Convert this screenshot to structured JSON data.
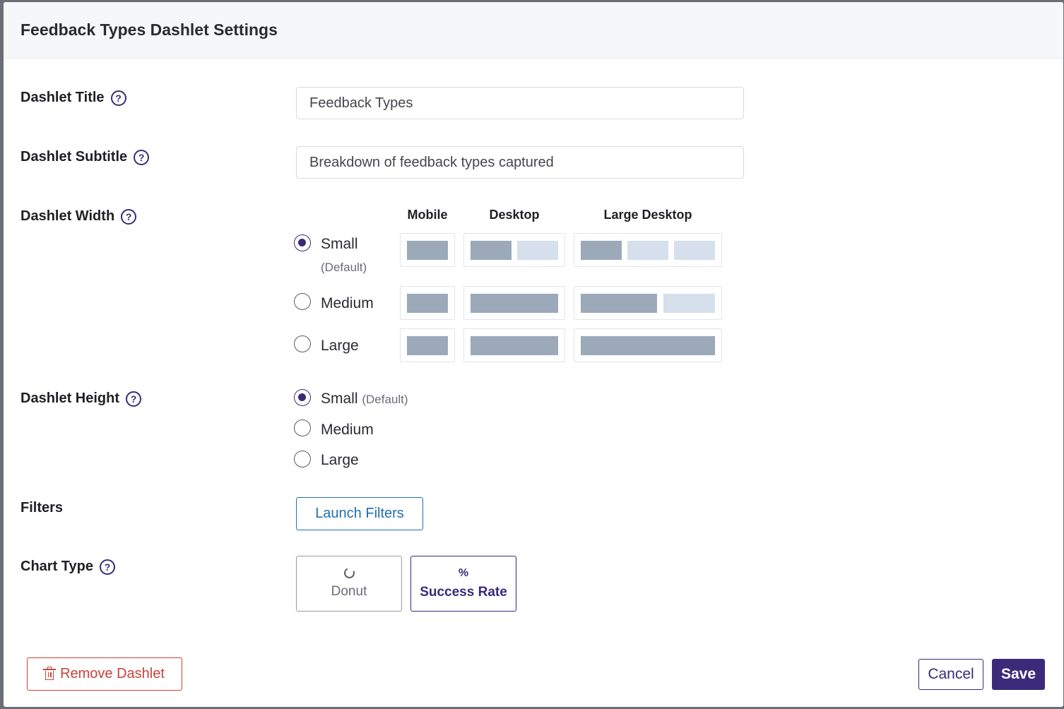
{
  "modal": {
    "title": "Feedback Types Dashlet Settings"
  },
  "fields": {
    "title": {
      "label": "Dashlet Title",
      "value": "Feedback Types",
      "help_icon": "question-circle-icon"
    },
    "subtitle": {
      "label": "Dashlet Subtitle",
      "value": "Breakdown of feedback types captured",
      "help_icon": "question-circle-icon"
    },
    "width": {
      "label": "Dashlet Width",
      "columns": [
        "Mobile",
        "Desktop",
        "Large Desktop"
      ],
      "options": [
        {
          "label": "Small",
          "note": "(Default)",
          "selected": true
        },
        {
          "label": "Medium",
          "selected": false
        },
        {
          "label": "Large",
          "selected": false
        }
      ]
    },
    "height": {
      "label": "Dashlet Height",
      "options": [
        {
          "label": "Small",
          "note": "(Default)",
          "selected": true
        },
        {
          "label": "Medium",
          "selected": false
        },
        {
          "label": "Large",
          "selected": false
        }
      ]
    },
    "filters": {
      "label": "Filters",
      "button_label": "Launch Filters"
    },
    "chart_type": {
      "label": "Chart Type",
      "options": [
        {
          "label": "Donut",
          "icon": "donut-icon",
          "selected": false
        },
        {
          "label": "Success Rate",
          "icon": "%",
          "selected": true
        }
      ]
    }
  },
  "footer": {
    "remove_label": "Remove Dashlet",
    "cancel_label": "Cancel",
    "save_label": "Save"
  },
  "colors": {
    "accent": "#3b2a7a",
    "link": "#1f6fb2",
    "danger": "#c8423a",
    "preview_filled": "#9ba9b8",
    "preview_empty": "#d6e0ec"
  }
}
